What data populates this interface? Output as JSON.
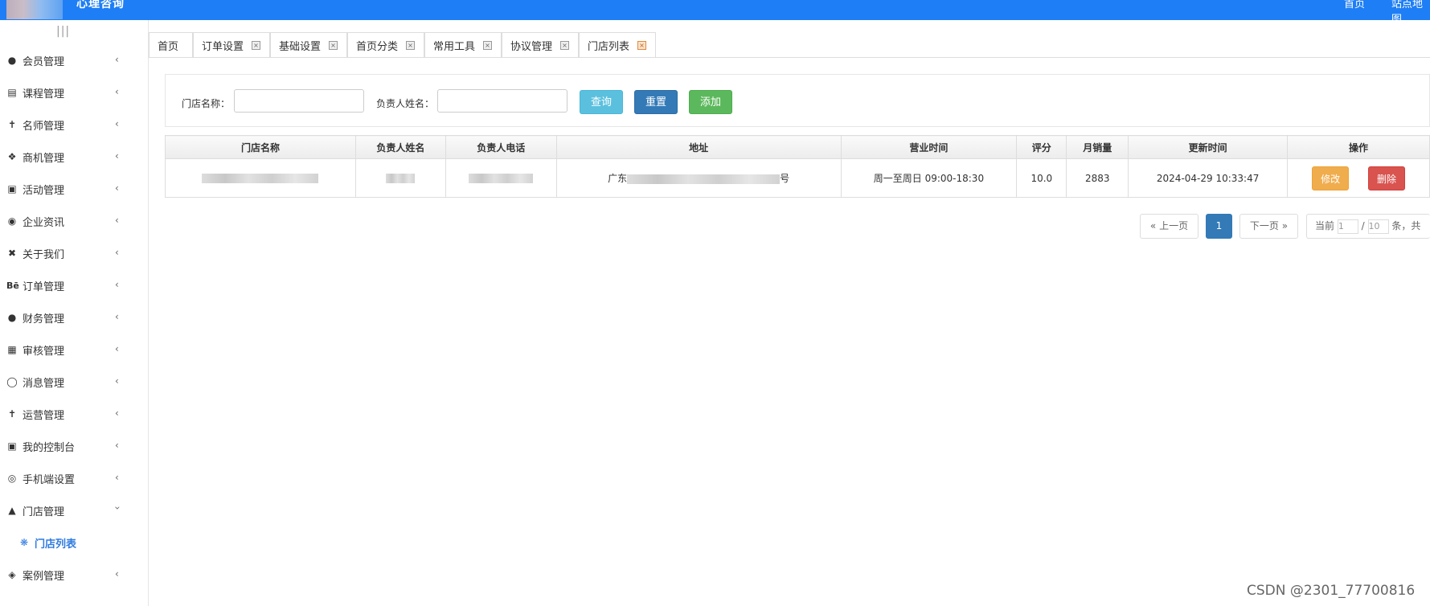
{
  "header": {
    "app_title": "心理咨询",
    "links": [
      "首页",
      "站点地图"
    ],
    "brand_color": "#1e7ef5"
  },
  "sidebar": {
    "toggle_icon": "|||",
    "items": [
      {
        "label": "会员管理",
        "icon": "users-icon"
      },
      {
        "label": "课程管理",
        "icon": "document-icon"
      },
      {
        "label": "名师管理",
        "icon": "person-icon"
      },
      {
        "label": "商机管理",
        "icon": "cubes-icon"
      },
      {
        "label": "活动管理",
        "icon": "y-combinator-icon"
      },
      {
        "label": "企业资讯",
        "icon": "camera-icon"
      },
      {
        "label": "关于我们",
        "icon": "joomla-icon"
      },
      {
        "label": "订单管理",
        "icon": "behance-icon"
      },
      {
        "label": "财务管理",
        "icon": "bomb-icon"
      },
      {
        "label": "审核管理",
        "icon": "building-icon"
      },
      {
        "label": "消息管理",
        "icon": "circle-notch-icon"
      },
      {
        "label": "运营管理",
        "icon": "child-icon"
      },
      {
        "label": "我的控制台",
        "icon": "car-icon"
      },
      {
        "label": "手机端设置",
        "icon": "life-ring-icon"
      },
      {
        "label": "门店管理",
        "icon": "bank-icon"
      },
      {
        "label": "案例管理",
        "icon": "cube-icon"
      }
    ],
    "expanded_item": "门店管理",
    "submenu": {
      "label": "门店列表",
      "icon": "asterisk-icon"
    }
  },
  "tabs": [
    {
      "label": "首页",
      "closable": false
    },
    {
      "label": "订单设置",
      "closable": true
    },
    {
      "label": "基础设置",
      "closable": true
    },
    {
      "label": "首页分类",
      "closable": true
    },
    {
      "label": "常用工具",
      "closable": true
    },
    {
      "label": "协议管理",
      "closable": true
    },
    {
      "label": "门店列表",
      "closable": true,
      "active": true
    }
  ],
  "filters": {
    "store_name_label": "门店名称：",
    "manager_name_label": "负责人姓名：",
    "query_label": "查询",
    "reset_label": "重置",
    "add_label": "添加"
  },
  "table": {
    "columns": [
      "门店名称",
      "负责人姓名",
      "负责人电话",
      "地址",
      "营业时间",
      "评分",
      "月销量",
      "更新时间",
      "操作"
    ],
    "rows": [
      {
        "store_name": "",
        "manager_name": "",
        "manager_phone": "",
        "address_prefix": "广东",
        "address_suffix": "号",
        "hours": "周一至周日 09:00-18:30",
        "rating": "10.0",
        "monthly_sales": "2883",
        "updated_at": "2024-04-29 10:33:47",
        "edit_label": "修改",
        "delete_label": "删除"
      }
    ]
  },
  "pagination": {
    "prev_label": "« 上一页",
    "current_page": "1",
    "next_label": "下一页 »",
    "current_prefix": "当前",
    "page_input": "1",
    "sep": "/",
    "page_size": "10",
    "suffix": "条，共"
  },
  "watermark": "CSDN @2301_77700816"
}
